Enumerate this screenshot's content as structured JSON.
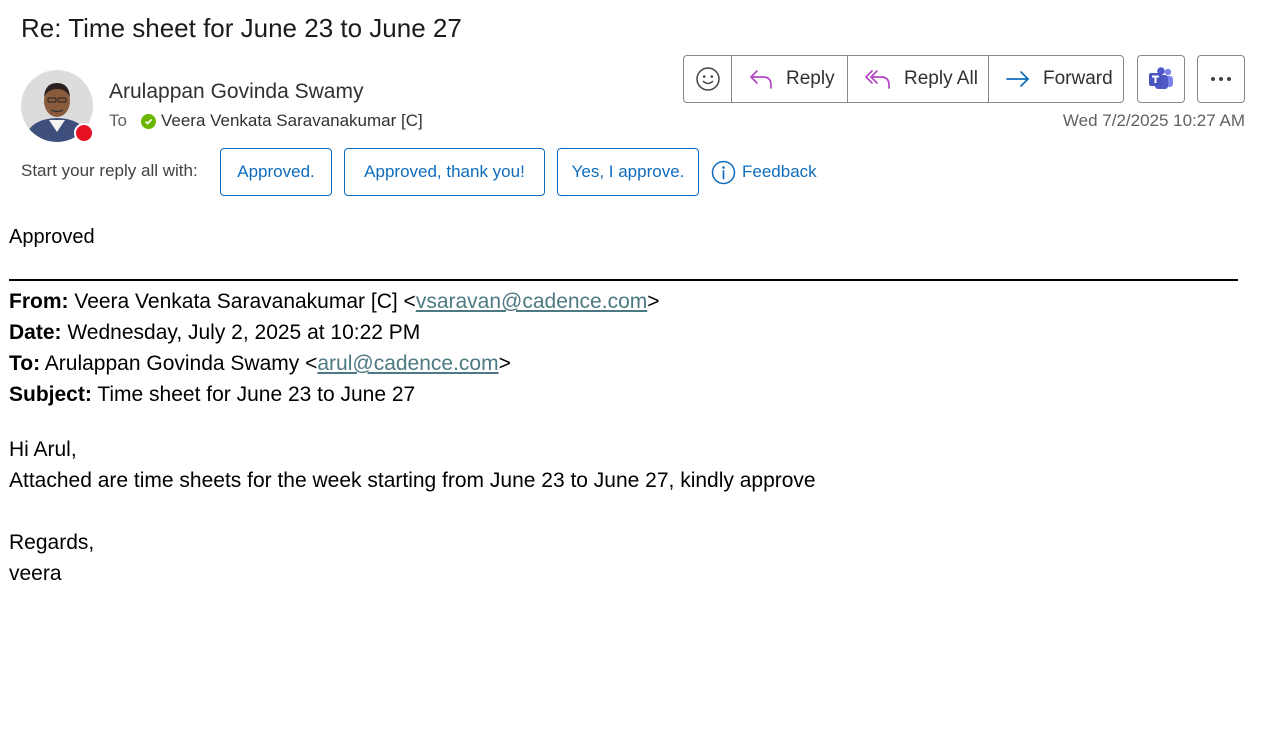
{
  "subject": "Re: Time sheet for June 23 to June 27",
  "sender": {
    "name": "Arulappan Govinda Swamy",
    "presence": "busy",
    "presence_color": "#e81123"
  },
  "recipients": {
    "label": "To",
    "name": "Veera Venkata Saravanakumar [C]",
    "presence_color": "#6bb700"
  },
  "timestamp": "Wed 7/2/2025 10:27 AM",
  "actions": {
    "emoji_icon": "smiley-icon",
    "reply": "Reply",
    "reply_all": "Reply All",
    "forward": "Forward",
    "teams_icon": "teams-icon",
    "more_icon": "more-icon"
  },
  "quick_replies": {
    "label": "Start your reply all with:",
    "options": [
      "Approved.",
      "Approved, thank you!",
      "Yes, I approve."
    ],
    "feedback": "Feedback"
  },
  "message": {
    "reply_text": "Approved",
    "original": {
      "from_label": "From:",
      "from_name": "Veera Venkata Saravanakumar [C] <",
      "from_email": "vsaravan@cadence.com",
      "from_close": ">",
      "date_label": "Date:",
      "date_value": "Wednesday, July 2, 2025 at 10:22 PM",
      "to_label": "To:",
      "to_name": "Arulappan Govinda Swamy <",
      "to_email": "arul@cadence.com",
      "to_close": ">",
      "subject_label": "Subject:",
      "subject_value": "Time sheet for June 23 to June 27",
      "greeting": "Hi Arul,",
      "body": "Attached are time sheets for the week starting from June 23 to June 27, kindly approve",
      "closing": "Regards,",
      "signature": "veera"
    }
  },
  "colors": {
    "accent": "#0f6cbd",
    "reply_icon": "#b146c2",
    "forward_icon": "#0f6cbd",
    "link": "#4d7a82"
  }
}
